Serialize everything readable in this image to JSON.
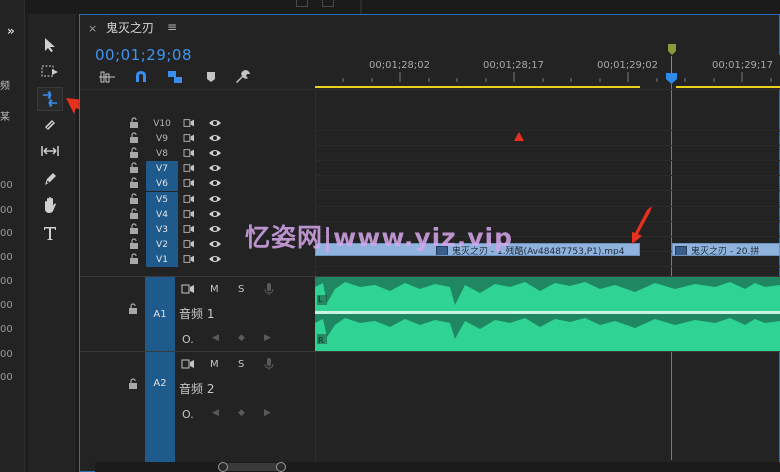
{
  "left_panel": {
    "labels": [
      "频",
      "某"
    ],
    "numbers": [
      "00",
      "00",
      "00",
      "00",
      "00",
      "00",
      "00",
      "00",
      "00"
    ],
    "collapse_icon": "double-chevron-right-icon"
  },
  "tools": [
    {
      "name": "selection-tool",
      "icon": "arrow-cursor-icon"
    },
    {
      "name": "track-select-forward-tool",
      "icon": "track-select-icon"
    },
    {
      "name": "ripple-edit-tool",
      "icon": "ripple-edit-icon",
      "active": true
    },
    {
      "name": "razor-tool",
      "icon": "razor-icon"
    },
    {
      "name": "slip-tool",
      "icon": "slip-icon"
    },
    {
      "name": "pen-tool",
      "icon": "pen-icon"
    },
    {
      "name": "hand-tool",
      "icon": "hand-icon"
    },
    {
      "name": "type-tool",
      "icon": "type-icon"
    }
  ],
  "timeline": {
    "close_label": "×",
    "sequence_name": "鬼灭之刃",
    "menu_label": "≡",
    "timecode": "00;01;29;08",
    "ruler_labels": [
      "00;01;28;02",
      "00;01;28;17",
      "00;01;29;02",
      "00;01;29;17"
    ]
  },
  "video_tracks": [
    {
      "name": "V10",
      "target": false
    },
    {
      "name": "V9",
      "target": false
    },
    {
      "name": "V8",
      "target": false
    },
    {
      "name": "V7",
      "target": true
    },
    {
      "name": "V6",
      "target": true
    },
    {
      "name": "V5",
      "target": true
    },
    {
      "name": "V4",
      "target": true
    },
    {
      "name": "V3",
      "target": true
    },
    {
      "name": "V2",
      "target": true
    },
    {
      "name": "V1",
      "target": true
    }
  ],
  "audio_tracks": [
    {
      "name": "A1",
      "label": "音频 1",
      "mute": "M",
      "solo": "S"
    },
    {
      "name": "A2",
      "label": "音频 2",
      "mute": "M",
      "solo": "S"
    }
  ],
  "clips": {
    "clip1_label": "鬼灭之刃 - 1.残酷(Av48487753,P1).mp4",
    "clip2_label": "鬼灭之刃 - 20.拼",
    "channel_left": "L",
    "channel_right": "R"
  },
  "watermark": "忆姿网|www.yiz.vip",
  "colors": {
    "accent_blue": "#2d8ceb",
    "waveform_green": "#2fd494",
    "clip_blue": "#8fb3dc",
    "track_target": "#1e5a8c",
    "annotation_red": "#e8301f",
    "work_area_yellow": "#e8d21a"
  }
}
